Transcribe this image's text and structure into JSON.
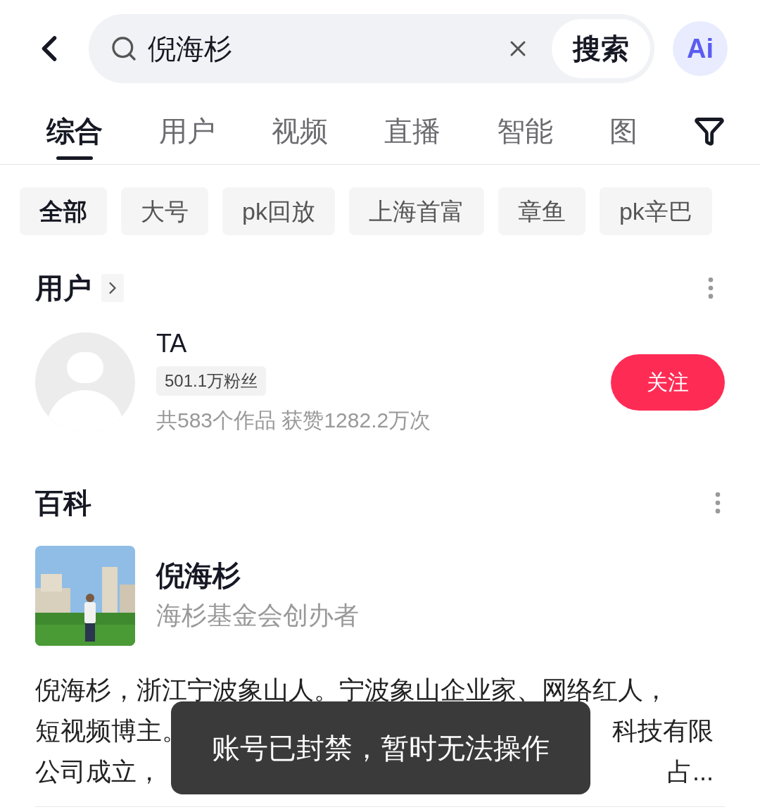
{
  "search": {
    "value": "倪海杉",
    "button": "搜索",
    "ai_label": "Ai"
  },
  "tabs": [
    {
      "label": "综合",
      "selected": true
    },
    {
      "label": "用户",
      "selected": false
    },
    {
      "label": "视频",
      "selected": false
    },
    {
      "label": "直播",
      "selected": false
    },
    {
      "label": "智能",
      "selected": false
    },
    {
      "label": "图",
      "selected": false
    }
  ],
  "chips": [
    {
      "label": "全部",
      "selected": true
    },
    {
      "label": "大号",
      "selected": false
    },
    {
      "label": "pk回放",
      "selected": false
    },
    {
      "label": "上海首富",
      "selected": false
    },
    {
      "label": "章鱼",
      "selected": false
    },
    {
      "label": "pk辛巴",
      "selected": false
    }
  ],
  "users_section": {
    "title": "用户",
    "user": {
      "name": "TA",
      "followers": "501.1万粉丝",
      "stats": "共583个作品 获赞1282.2万次",
      "follow_button": "关注"
    }
  },
  "wiki_section": {
    "title": "百科",
    "entry": {
      "kind": "picture",
      "name": "倪海杉",
      "subtitle": "海杉基金会创办者",
      "description_lines": [
        {
          "parts": [
            "倪海杉，浙江宁波象山人。宁波象山企业家、网络红人，"
          ]
        },
        {
          "parts": [
            "短视频博主。",
            "科技有限"
          ]
        },
        {
          "parts": [
            "公司成立，",
            "占..."
          ]
        }
      ]
    }
  },
  "toast": "账号已封禁，暂时无法操作"
}
